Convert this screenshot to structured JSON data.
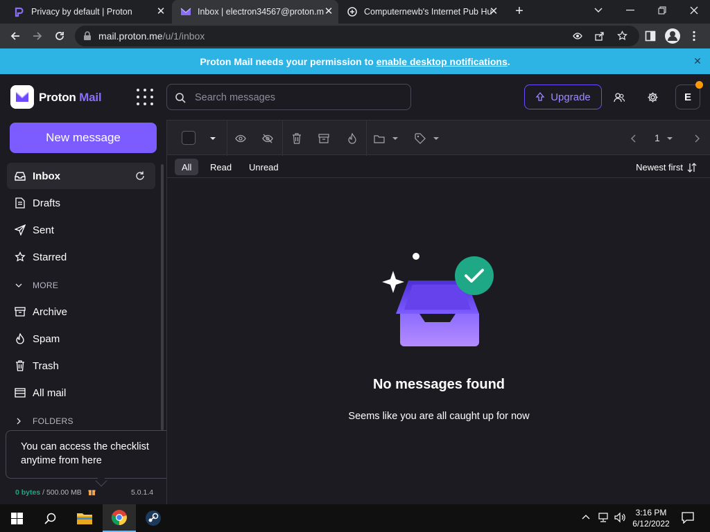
{
  "browser": {
    "tabs": [
      {
        "title": "Privacy by default | Proton",
        "icon": "proton-icon",
        "active": false
      },
      {
        "title": "Inbox | electron34567@proton.m",
        "icon": "proton-mail-icon",
        "active": true
      },
      {
        "title": "Computernewb's Internet Pub Hu",
        "icon": "pub-icon",
        "active": false
      }
    ],
    "url_host": "mail.proton.me",
    "url_path": "/u/1/inbox"
  },
  "banner": {
    "prefix": "Proton Mail needs your permission to ",
    "link": "enable desktop notifications",
    "suffix": "."
  },
  "header": {
    "logo_word1": "Proton",
    "logo_word2": "Mail",
    "search_placeholder": "Search messages",
    "upgrade_label": "Upgrade",
    "avatar_initial": "E"
  },
  "sidebar": {
    "new_message_label": "New message",
    "items": [
      {
        "label": "Inbox",
        "icon": "inbox-icon",
        "active": true
      },
      {
        "label": "Drafts",
        "icon": "drafts-icon"
      },
      {
        "label": "Sent",
        "icon": "sent-icon"
      },
      {
        "label": "Starred",
        "icon": "star-icon"
      }
    ],
    "more_label": "MORE",
    "more_items": [
      {
        "label": "Archive",
        "icon": "archive-icon"
      },
      {
        "label": "Spam",
        "icon": "spam-icon"
      },
      {
        "label": "Trash",
        "icon": "trash-icon"
      },
      {
        "label": "All mail",
        "icon": "all-mail-icon"
      }
    ],
    "folders_label": "FOLDERS",
    "tooltip_text_line1": "You can access the checklist",
    "tooltip_text_line2": "anytime from here",
    "storage_used": "0 bytes",
    "storage_total": " / 500.00 MB",
    "version": "5.0.1.4"
  },
  "toolbar": {
    "page": "1"
  },
  "filters": {
    "all": "All",
    "read": "Read",
    "unread": "Unread",
    "sort_label": "Newest first"
  },
  "empty": {
    "title": "No messages found",
    "subtitle": "Seems like you are all caught up for now"
  },
  "taskbar": {
    "time": "3:16 PM",
    "date": "6/12/2022"
  },
  "colors": {
    "accent": "#6d4aff",
    "banner": "#2eb3e5",
    "background": "#1c1b22"
  }
}
